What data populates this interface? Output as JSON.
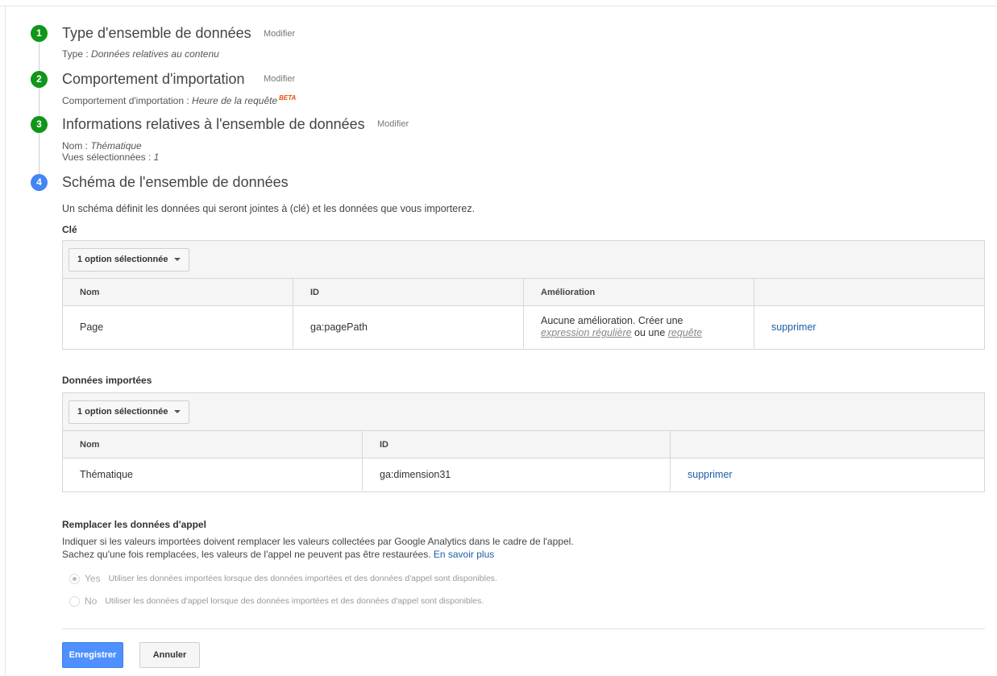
{
  "steps": [
    {
      "number": "1",
      "title": "Type d'ensemble de données",
      "modify_label": "Modifier",
      "summary_label": "Type :",
      "summary_value": "Données relatives au contenu"
    },
    {
      "number": "2",
      "title": "Comportement d'importation",
      "modify_label": "Modifier",
      "summary_label": "Comportement d'importation :",
      "summary_value": "Heure de la requête",
      "badge": "BETA"
    },
    {
      "number": "3",
      "title": "Informations relatives à l'ensemble de données",
      "modify_label": "Modifier",
      "name_label": "Nom :",
      "name_value": "Thématique",
      "views_label": "Vues sélectionnées :",
      "views_value": "1"
    },
    {
      "number": "4",
      "title": "Schéma de l'ensemble de données"
    }
  ],
  "schema": {
    "description": "Un schéma définit les données qui seront jointes à (clé) et les données que vous importerez.",
    "key_section": {
      "label": "Clé",
      "dropdown_label": "1 option sélectionnée",
      "headers": [
        "Nom",
        "ID",
        "Amélioration",
        ""
      ],
      "row": {
        "name": "Page",
        "id": "ga:pagePath",
        "improvement_text": "Aucune amélioration. Créer une",
        "regex_link": "expression régulière",
        "or_text": " ou une ",
        "query_link": "requête",
        "delete_link": "supprimer"
      }
    },
    "imported_section": {
      "label": "Données importées",
      "dropdown_label": "1 option sélectionnée",
      "headers": [
        "Nom",
        "ID",
        ""
      ],
      "row": {
        "name": "Thématique",
        "id": "ga:dimension31",
        "delete_link": "supprimer"
      }
    }
  },
  "replace": {
    "title": "Remplacer les données d'appel",
    "line1": "Indiquer si les valeurs importées doivent remplacer les valeurs collectées par Google Analytics dans le cadre de l'appel.",
    "line2": "Sachez qu'une fois remplacées, les valeurs de l'appel ne peuvent pas être restaurées.",
    "learn_more": "En savoir plus",
    "options": [
      {
        "label": "Yes",
        "description": "Utiliser les données importées lorsque des données importées et des données d'appel sont disponibles.",
        "checked": true
      },
      {
        "label": "No",
        "description": "Utiliser les données d'appel lorsque des données importées et des données d'appel sont disponibles.",
        "checked": false
      }
    ]
  },
  "actions": {
    "save_label": "Enregistrer",
    "cancel_label": "Annuler"
  },
  "colors": {
    "step_done": "#109618",
    "step_active": "#4285f4",
    "primary_button": "#4d90fe",
    "link": "#1a5ea8",
    "beta": "#e65100"
  }
}
